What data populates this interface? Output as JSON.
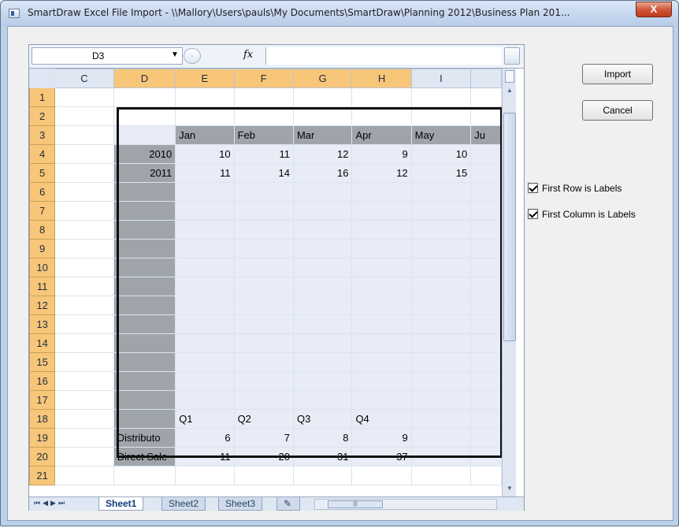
{
  "window": {
    "title": "SmartDraw Excel File Import - \\\\Mallory\\Users\\pauls\\My Documents\\SmartDraw\\Planning 2012\\Business Plan 201...",
    "close_label": "X"
  },
  "formula_bar": {
    "name_box": "D3",
    "fx_label": "fx",
    "formula": ""
  },
  "grid": {
    "columns": [
      "C",
      "D",
      "E",
      "F",
      "G",
      "H",
      "I",
      ""
    ],
    "rows": [
      {
        "n": "1",
        "cells": [
          "",
          "",
          "",
          "",
          "",
          "",
          "",
          ""
        ]
      },
      {
        "n": "2",
        "cells": [
          "",
          "",
          "",
          "",
          "",
          "",
          "",
          ""
        ]
      },
      {
        "n": "3",
        "cells": [
          "",
          "",
          "Jan",
          "Feb",
          "Mar",
          "Apr",
          "May",
          "Ju"
        ]
      },
      {
        "n": "4",
        "cells": [
          "",
          "2010",
          "10",
          "11",
          "12",
          "9",
          "10",
          ""
        ]
      },
      {
        "n": "5",
        "cells": [
          "",
          "2011",
          "11",
          "14",
          "16",
          "12",
          "15",
          ""
        ]
      },
      {
        "n": "6",
        "cells": [
          "",
          "",
          "",
          "",
          "",
          "",
          "",
          ""
        ]
      },
      {
        "n": "7",
        "cells": [
          "",
          "",
          "",
          "",
          "",
          "",
          "",
          ""
        ]
      },
      {
        "n": "8",
        "cells": [
          "",
          "",
          "",
          "",
          "",
          "",
          "",
          ""
        ]
      },
      {
        "n": "9",
        "cells": [
          "",
          "",
          "",
          "",
          "",
          "",
          "",
          ""
        ]
      },
      {
        "n": "10",
        "cells": [
          "",
          "",
          "",
          "",
          "",
          "",
          "",
          ""
        ]
      },
      {
        "n": "11",
        "cells": [
          "",
          "",
          "",
          "",
          "",
          "",
          "",
          ""
        ]
      },
      {
        "n": "12",
        "cells": [
          "",
          "",
          "",
          "",
          "",
          "",
          "",
          ""
        ]
      },
      {
        "n": "13",
        "cells": [
          "",
          "",
          "",
          "",
          "",
          "",
          "",
          ""
        ]
      },
      {
        "n": "14",
        "cells": [
          "",
          "",
          "",
          "",
          "",
          "",
          "",
          ""
        ]
      },
      {
        "n": "15",
        "cells": [
          "",
          "",
          "",
          "",
          "",
          "",
          "",
          ""
        ]
      },
      {
        "n": "16",
        "cells": [
          "",
          "",
          "",
          "",
          "",
          "",
          "",
          ""
        ]
      },
      {
        "n": "17",
        "cells": [
          "",
          "",
          "",
          "",
          "",
          "",
          "",
          ""
        ]
      },
      {
        "n": "18",
        "cells": [
          "",
          "",
          "Q1",
          "Q2",
          "Q3",
          "Q4",
          "",
          ""
        ]
      },
      {
        "n": "19",
        "cells": [
          "",
          "Distributo",
          "6",
          "7",
          "8",
          "9",
          "",
          ""
        ]
      },
      {
        "n": "20",
        "cells": [
          "",
          "Direct Sale",
          "11",
          "20",
          "31",
          "37",
          "",
          ""
        ]
      },
      {
        "n": "21",
        "cells": [
          "",
          "",
          "",
          "",
          "",
          "",
          "",
          ""
        ]
      }
    ]
  },
  "sheet_tabs": [
    "Sheet1",
    "Sheet2",
    "Sheet3"
  ],
  "buttons": {
    "import": "Import",
    "cancel": "Cancel"
  },
  "options": {
    "first_row_labels": {
      "label": "First Row is Labels",
      "checked": true
    },
    "first_column_labels": {
      "label": "First Column is Labels",
      "checked": true
    }
  }
}
